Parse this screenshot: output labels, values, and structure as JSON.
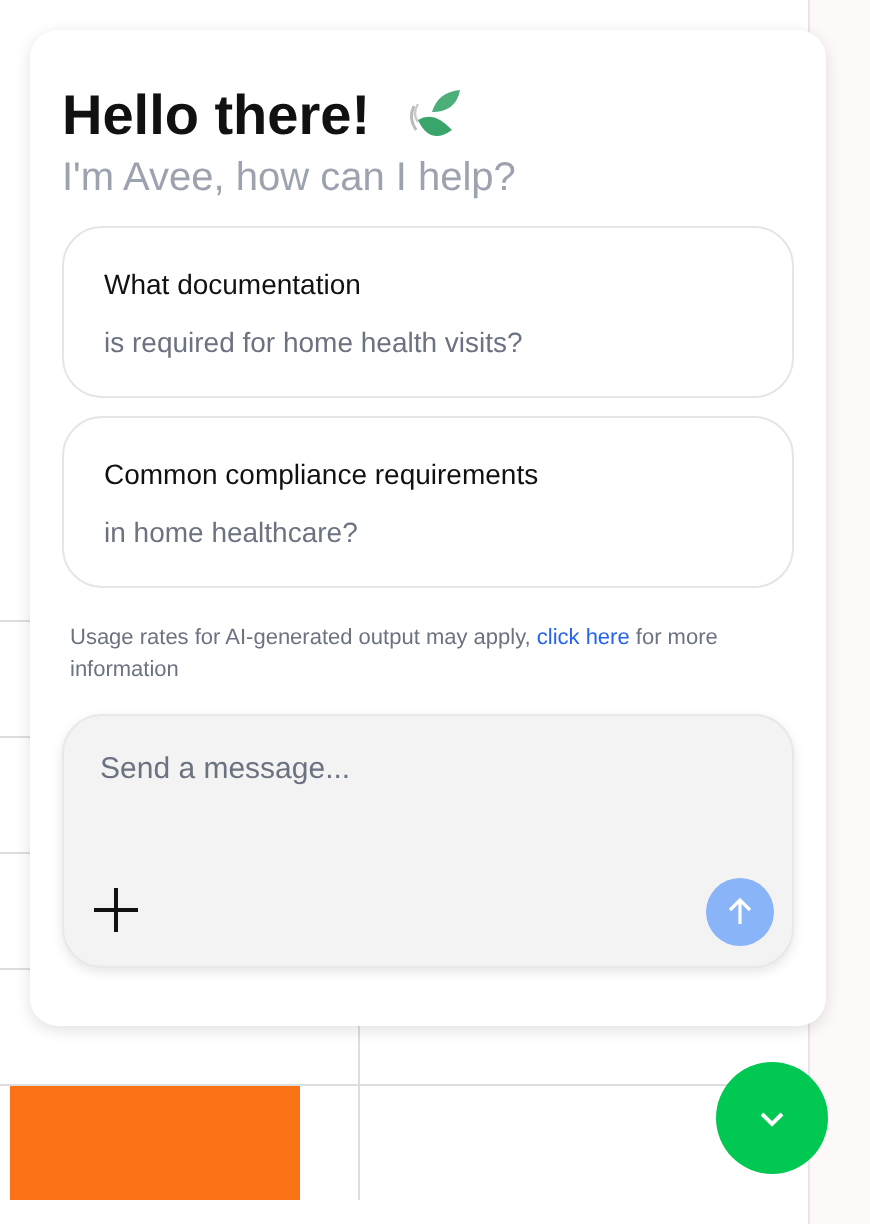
{
  "chat": {
    "title": "Hello there!",
    "subtitle": "I'm Avee, how can I help?",
    "suggestions": [
      {
        "title": "What documentation",
        "subtitle": "is required for home health visits?"
      },
      {
        "title": "Common compliance requirements",
        "subtitle": "in home healthcare?"
      }
    ],
    "disclaimer": {
      "before": "Usage rates for AI-generated output may apply, ",
      "link": "click here",
      "after": " for more information"
    },
    "composer": {
      "placeholder": "Send a message..."
    }
  }
}
